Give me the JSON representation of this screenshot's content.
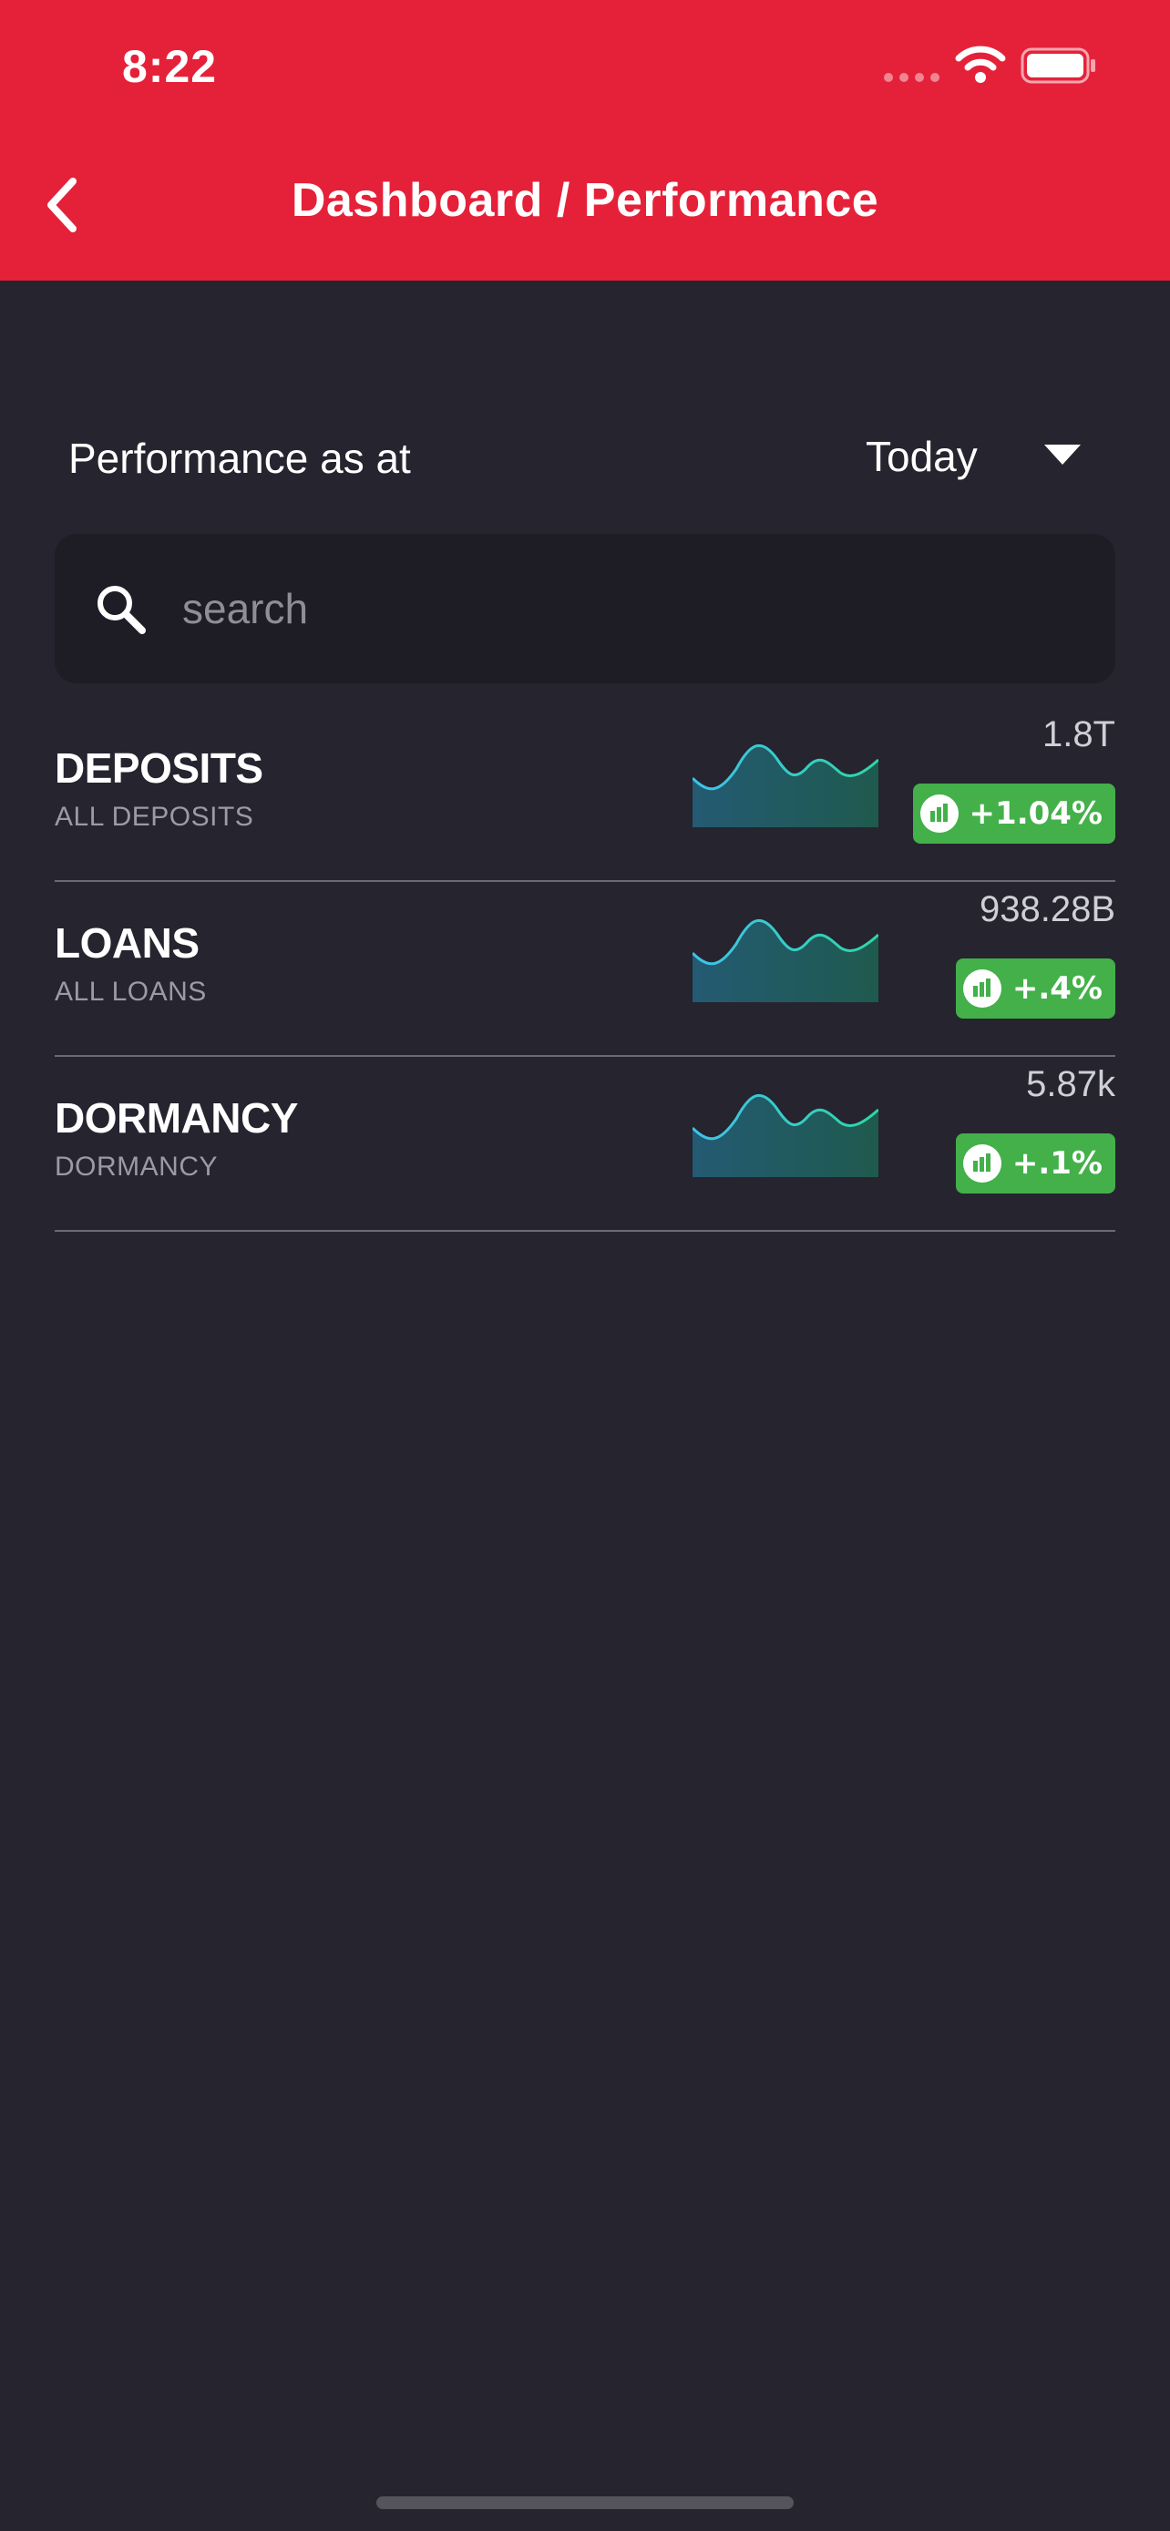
{
  "status_bar": {
    "time": "8:22"
  },
  "header": {
    "title": "Dashboard / Performance"
  },
  "filter": {
    "label": "Performance as at",
    "period": "Today"
  },
  "search": {
    "placeholder": "search"
  },
  "metrics": [
    {
      "title": "DEPOSITS",
      "subtitle": "ALL DEPOSITS",
      "value": "1.8T",
      "change": "+1.04%"
    },
    {
      "title": "LOANS",
      "subtitle": "ALL LOANS",
      "value": "938.28B",
      "change": "+.4%"
    },
    {
      "title": "DORMANCY",
      "subtitle": "DORMANCY",
      "value": "5.87k",
      "change": "+.1%"
    }
  ],
  "colors": {
    "header": "#e52139",
    "background": "#25242f",
    "badge": "#43b04a",
    "sparkline_start": "#3ec3e8",
    "sparkline_end": "#2ed6a8"
  }
}
